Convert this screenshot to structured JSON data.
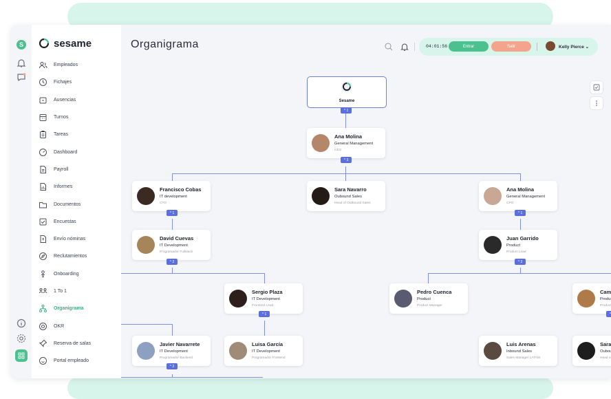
{
  "brand": {
    "name": "sesame"
  },
  "sidebar": {
    "items": [
      {
        "label": "Empleados",
        "icon": "users-icon"
      },
      {
        "label": "Fichajes",
        "icon": "clock-icon"
      },
      {
        "label": "Ausencias",
        "icon": "calendar-icon"
      },
      {
        "label": "Turnos",
        "icon": "schedule-icon"
      },
      {
        "label": "Tareas",
        "icon": "clipboard-icon"
      },
      {
        "label": "Dashboard",
        "icon": "dashboard-icon"
      },
      {
        "label": "Payroll",
        "icon": "document-icon"
      },
      {
        "label": "Informes",
        "icon": "report-icon"
      },
      {
        "label": "Documentos",
        "icon": "folder-icon"
      },
      {
        "label": "Encuestas",
        "icon": "survey-icon"
      },
      {
        "label": "Envío nóminas",
        "icon": "payslip-icon"
      },
      {
        "label": "Reclutamientos",
        "icon": "compass-icon"
      },
      {
        "label": "Onboarding",
        "icon": "onboarding-icon"
      },
      {
        "label": "1 To 1",
        "icon": "one-to-one-icon"
      },
      {
        "label": "Organigrama",
        "icon": "org-chart-icon"
      },
      {
        "label": "OKR",
        "icon": "target-icon"
      },
      {
        "label": "Reserva de salas",
        "icon": "pin-icon"
      },
      {
        "label": "Portal empleado",
        "icon": "smile-icon"
      }
    ],
    "active": "Organigrama"
  },
  "header": {
    "title": "Organigrama",
    "time": "04:01:56",
    "entrar_label": "Entrar",
    "salir_label": "Salir",
    "user_name": "Kelly Pierce"
  },
  "colors": {
    "accent": "#4cc08f",
    "salir": "#f4a48c",
    "badge": "#5a6fdc"
  },
  "org": {
    "root": {
      "name": "Sesame",
      "badge": "1"
    },
    "ceo": {
      "name": "Ana Molina",
      "dept": "General Management",
      "role": "CEO",
      "badge": "3"
    },
    "level2": [
      {
        "name": "Francisco Cobas",
        "dept": "IT development",
        "role": "CTO",
        "badge": "1"
      },
      {
        "name": "Sara Navarro",
        "dept": "Oubound Sales",
        "role": "Head of Outbound Sales"
      },
      {
        "name": "Ana Molina",
        "dept": "General Management",
        "role": "CPO",
        "badge": "1"
      }
    ],
    "level3": [
      {
        "name": "David Cuevas",
        "dept": "IT Development",
        "role": "Programador Fullstack",
        "badge": "2"
      },
      {
        "name": "Juan Garrido",
        "dept": "Product",
        "role": "Product Lead",
        "badge": "2"
      }
    ],
    "level4": [
      {
        "name": "Sergio Plaza",
        "dept": "IT Development",
        "role": "Frontend Lead",
        "badge": "1"
      },
      {
        "name": "Pedro Cuenca",
        "dept": "Product",
        "role": "Product Manager"
      },
      {
        "name": "Camila F",
        "dept": "Product",
        "role": "Product Ma",
        "badge": "3"
      }
    ],
    "level5": [
      {
        "name": "Javier Navarrete",
        "dept": "IT Development",
        "role": "Programador Backend",
        "badge": "2"
      },
      {
        "name": "Luisa García",
        "dept": "IT Development",
        "role": "Programador Frontend"
      },
      {
        "name": "Luis Arenas",
        "dept": "Inbound Sales",
        "role": "Sales Manager LATAM"
      },
      {
        "name": "Sara Na",
        "dept": "Oubound",
        "role": "Head of Ou"
      }
    ]
  }
}
